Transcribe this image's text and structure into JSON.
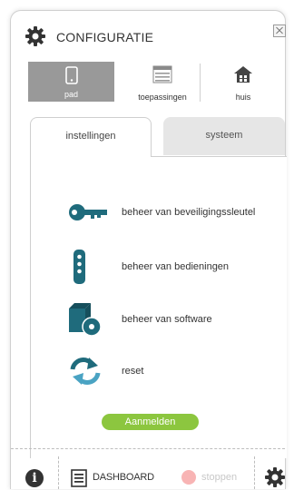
{
  "header": {
    "title": "CONFIGURATIE",
    "settings_icon": "gear-icon",
    "close_icon": "close-icon"
  },
  "modes": [
    {
      "label": "pad",
      "icon": "tablet-icon",
      "selected": true
    },
    {
      "label": "toepassingen",
      "icon": "app-list-icon",
      "selected": false
    },
    {
      "label": "huis",
      "icon": "house-icon",
      "selected": false
    }
  ],
  "tabs": [
    {
      "label": "instellingen",
      "active": true
    },
    {
      "label": "systeem",
      "active": false
    }
  ],
  "menu": [
    {
      "label": "beheer van beveiligingssleutel",
      "icon": "key-icon"
    },
    {
      "label": "beheer van bedieningen",
      "icon": "remote-control-icon"
    },
    {
      "label": "beheer van software",
      "icon": "software-box-icon"
    },
    {
      "label": "reset",
      "icon": "reset-arrows-icon"
    }
  ],
  "login_button": "Aanmelden",
  "footer": {
    "info_icon": "info-icon",
    "info_glyph": "i",
    "dashboard_label": "DASHBOARD",
    "dashboard_icon": "dashboard-list-icon",
    "stop_label": "stoppen",
    "stop_icon": "stop-dot-icon",
    "settings_icon": "gear-icon"
  },
  "colors": {
    "accent_teal": "#1f6b7c",
    "button_green": "#8cc63f",
    "selected_mode_gray": "#999999",
    "stop_red": "#f8b4b4"
  }
}
